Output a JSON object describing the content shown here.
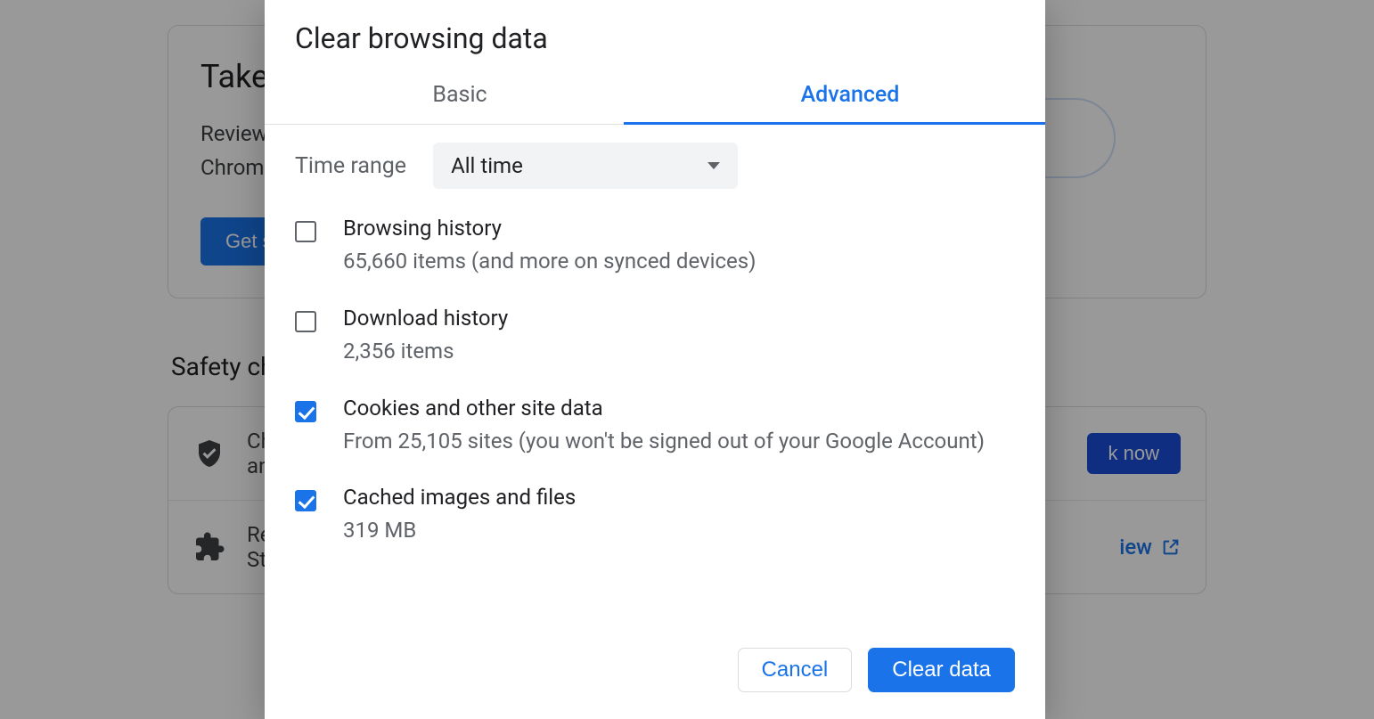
{
  "background": {
    "card_title": "Take th",
    "card_subtitle_line1": "Review ke",
    "card_subtitle_line2": "Chrome",
    "get_started_label": "Get sta",
    "safety_heading": "Safety chec",
    "row1_text": "Chr",
    "row1_text2": "and",
    "row1_action": "k now",
    "row2_text": "Revi",
    "row2_text2": "Store",
    "row2_action": "iew"
  },
  "dialog": {
    "title": "Clear browsing data",
    "tabs": {
      "basic": "Basic",
      "advanced": "Advanced"
    },
    "time_label": "Time range",
    "time_value": "All time",
    "items": [
      {
        "title": "Browsing history",
        "subtitle": "65,660 items (and more on synced devices)",
        "checked": false
      },
      {
        "title": "Download history",
        "subtitle": "2,356 items",
        "checked": false
      },
      {
        "title": "Cookies and other site data",
        "subtitle": "From 25,105 sites (you won't be signed out of your Google Account)",
        "checked": true
      },
      {
        "title": "Cached images and files",
        "subtitle": "319 MB",
        "checked": true
      }
    ],
    "cancel_label": "Cancel",
    "clear_label": "Clear data"
  }
}
